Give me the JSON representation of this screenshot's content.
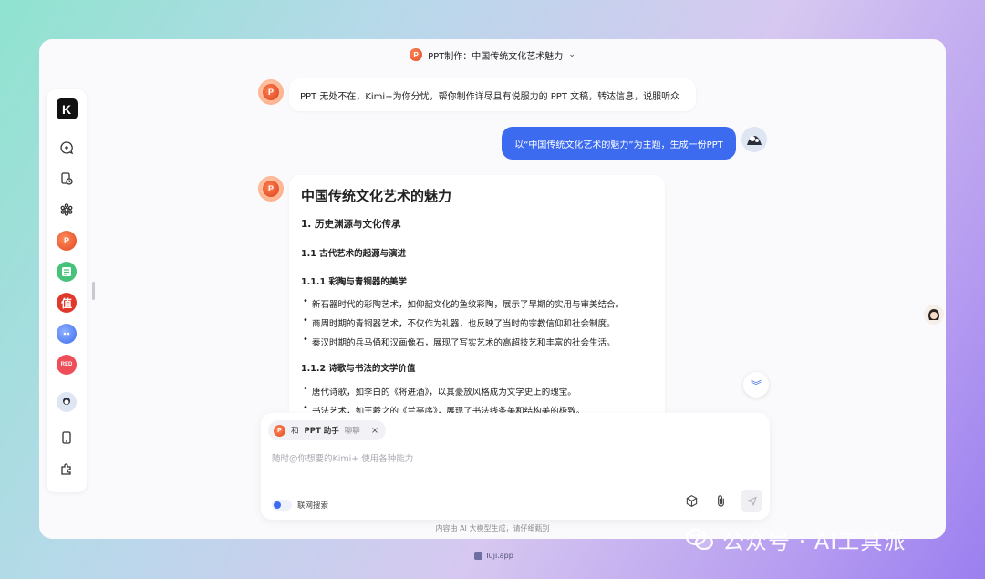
{
  "window": {
    "title": "PPT制作：中国传统文化艺术魅力"
  },
  "sidebar": {
    "logo": "K",
    "apps": [
      {
        "name": "ppt-app",
        "label": "P",
        "color": "#f26a3d"
      },
      {
        "name": "sheet-app",
        "label": "",
        "color": "#46c27a"
      },
      {
        "name": "zhi-app",
        "label": "值",
        "color": "#e0392b"
      },
      {
        "name": "blue-app",
        "label": "",
        "color": "#4f7df3"
      },
      {
        "name": "red-app",
        "label": "RED",
        "color": "#ef4d57"
      }
    ]
  },
  "messages": {
    "bot_intro": "PPT 无处不在，Kimi+为你分忧，帮你制作详尽且有说服力的 PPT 文稿，转达信息，说服听众",
    "user_prompt": "以“中国传统文化艺术的魅力”为主题，生成一份PPT",
    "doc": {
      "title": "中国传统文化艺术的魅力",
      "h1": "1. 历史渊源与文化传承",
      "h1_1": "1.1 古代艺术的起源与演进",
      "h1_1_1": "1.1.1 彩陶与青铜器的美学",
      "list1": [
        "新石器时代的彩陶艺术，如仰韶文化的鱼纹彩陶，展示了早期的实用与审美结合。",
        "商周时期的青铜器艺术，不仅作为礼器，也反映了当时的宗教信仰和社会制度。",
        "秦汉时期的兵马俑和汉画像石，展现了写实艺术的高超技艺和丰富的社会生活。"
      ],
      "h1_1_2": "1.1.2 诗歌与书法的文学价值",
      "list2": [
        "唐代诗歌，如李白的《将进酒》，以其豪放风格成为文学史上的瑰宝。",
        "书法艺术，如王羲之的《兰亭序》，展现了书法线条美和结构美的极致。"
      ]
    }
  },
  "composer": {
    "chip_prefix": "和",
    "chip_name": "PPT 助手",
    "chip_suffix": "聊聊",
    "chip_close": "×",
    "placeholder": "随时@你想要的Kimi+ 使用各种能力",
    "web_search_label": "联网搜索"
  },
  "footer": {
    "disclaimer": "内容由 AI 大模型生成，请仔细甄别",
    "tuji": "Tuji.app",
    "watermark": "公众号 · AI工具派"
  }
}
